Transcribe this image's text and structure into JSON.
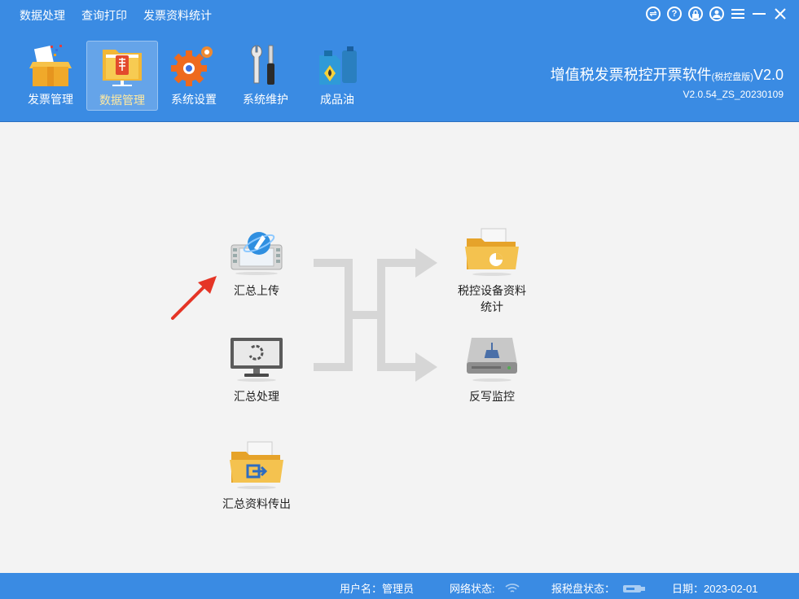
{
  "menu": [
    "数据处理",
    "查询打印",
    "发票资料统计"
  ],
  "window_controls": [
    "switch-icon",
    "help-icon",
    "lock-icon",
    "user-icon",
    "menu-icon",
    "minimize-icon",
    "close-icon"
  ],
  "toolbar": [
    {
      "label": "发票管理",
      "icon": "invoice-box-icon",
      "active": false
    },
    {
      "label": "数据管理",
      "icon": "data-folder-icon",
      "active": true
    },
    {
      "label": "系统设置",
      "icon": "gears-icon",
      "active": false
    },
    {
      "label": "系统维护",
      "icon": "tools-icon",
      "active": false
    },
    {
      "label": "成品油",
      "icon": "oil-can-icon",
      "active": false
    }
  ],
  "brand": {
    "title": "增值税发票税控开票软件",
    "edition": "(税控盘版)",
    "version_suffix": "V2.0",
    "build": "V2.0.54_ZS_20230109"
  },
  "functions": {
    "upload": "汇总上传",
    "process": "汇总处理",
    "export": "汇总资料传出",
    "device_stats_line1": "税控设备资料",
    "device_stats_line2": "统计",
    "writeback": "反写监控"
  },
  "status": {
    "user_label": "用户名：",
    "user_value": "管理员",
    "network_label": "网络状态:",
    "disk_label": "报税盘状态：",
    "date_label": "日期：",
    "date_value": "2023-02-01"
  },
  "colors": {
    "header_blue": "#3a8be3",
    "content_bg": "#f3f3f3",
    "arrow_red": "#e53526",
    "flow_gray": "#d6d6d6"
  }
}
